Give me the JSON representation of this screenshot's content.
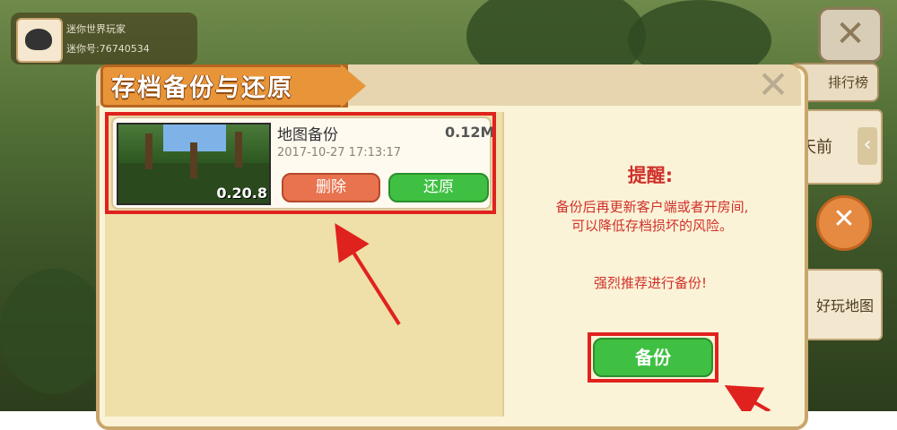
{
  "profile": {
    "name_text": "迷你世界玩家",
    "id_text": "迷你号:76740534"
  },
  "side": {
    "tab_text": "排行榜",
    "card_text": "天前",
    "map_text": "好玩地图"
  },
  "dialog": {
    "title": "存档备份与还原",
    "save": {
      "name": "地图备份",
      "size": "0.12M",
      "date": "2017-10-27 17:13:17",
      "version": "0.20.8",
      "delete_label": "删除",
      "restore_label": "还原"
    },
    "reminder": {
      "title": "提醒:",
      "body_line1": "备份后再更新客户端或者开房间,",
      "body_line2": "可以降低存档损坏的风险。",
      "strong": "强烈推荐进行备份!"
    },
    "backup_label": "备份"
  },
  "colors": {
    "accent_orange": "#e8953a",
    "button_green": "#3fc042",
    "button_red": "#e8734e",
    "highlight_red": "#e0221e"
  }
}
